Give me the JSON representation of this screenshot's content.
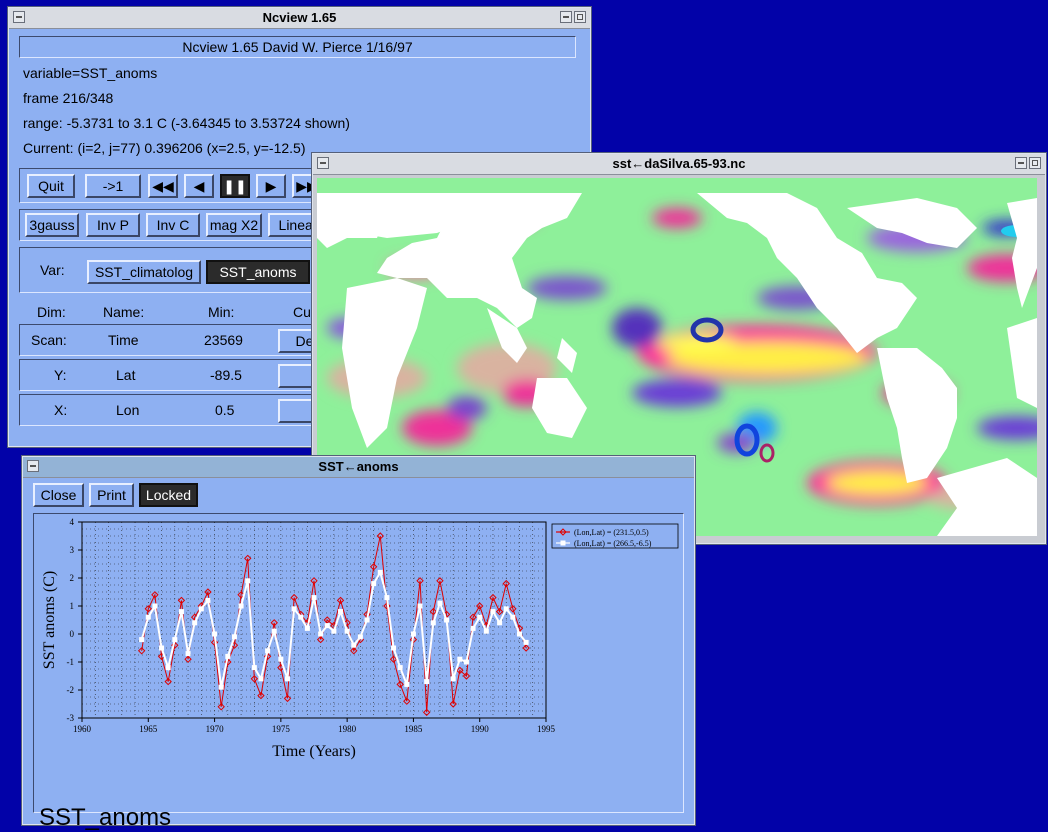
{
  "desktop": {
    "background": "#0202a8"
  },
  "ncview": {
    "title": "Ncview  1.65",
    "header": "Ncview 1.65 David W. Pierce 1/16/97",
    "variable": "variable=SST_anoms",
    "frame": "frame 216/348",
    "range": "range: -5.3731 to 3.1 C (-3.64345 to 3.53724 shown)",
    "current": "Current: (i=2, j=77) 0.396206 (x=2.5, y=-12.5)",
    "buttons": {
      "quit": "Quit",
      "restart": "->1"
    },
    "playback_icons": [
      "fast-backward-icon",
      "step-back-icon",
      "pause-icon",
      "step-forward-icon",
      "fast-forward-icon"
    ],
    "options": [
      "3gauss",
      "Inv P",
      "Inv C",
      "mag X2",
      "Linear"
    ],
    "var_label": "Var:",
    "vars": [
      "SST_climatolog",
      "SST_anoms"
    ],
    "dim_headers": {
      "dim": "Dim:",
      "name": "Name:",
      "min": "Min:",
      "cur": "Cu"
    },
    "dims": [
      {
        "dim": "Scan:",
        "name": "Time",
        "min": "23569",
        "btn": "Dec"
      },
      {
        "dim": "Y:",
        "name": "Lat",
        "min": "-89.5",
        "btn": ""
      },
      {
        "dim": "X:",
        "name": "Lon",
        "min": "0.5",
        "btn": ""
      }
    ]
  },
  "map_window": {
    "title": "sst←daSilva.65-93.nc"
  },
  "plot_window": {
    "title": "SST←anoms",
    "buttons": {
      "close": "Close",
      "print": "Print",
      "locked": "Locked"
    },
    "footer_label": "SST_anoms"
  },
  "chart_data": {
    "type": "line",
    "xlabel": "Time (Years)",
    "ylabel": "SST  anoms (C)",
    "xlim": [
      1960,
      1995
    ],
    "ylim": [
      -3,
      4
    ],
    "xticks": [
      1960,
      1965,
      1970,
      1975,
      1980,
      1985,
      1990,
      1995
    ],
    "yticks": [
      -3,
      -2,
      -1,
      0,
      1,
      2,
      3,
      4
    ],
    "grid": true,
    "legend_position": "top-right",
    "series": [
      {
        "name": "(Lon,Lat) = (231.5,0.5)",
        "color": "#e00000",
        "marker": "diamond",
        "x": [
          1964.5,
          1965.0,
          1965.5,
          1966.0,
          1966.5,
          1967.0,
          1967.5,
          1968.0,
          1968.5,
          1969.0,
          1969.5,
          1970.0,
          1970.5,
          1971.0,
          1971.5,
          1972.0,
          1972.5,
          1973.0,
          1973.5,
          1974.0,
          1974.5,
          1975.0,
          1975.5,
          1976.0,
          1976.5,
          1977.0,
          1977.5,
          1978.0,
          1978.5,
          1979.0,
          1979.5,
          1980.0,
          1980.5,
          1981.0,
          1981.5,
          1982.0,
          1982.5,
          1983.0,
          1983.5,
          1984.0,
          1984.5,
          1985.0,
          1985.5,
          1986.0,
          1986.5,
          1987.0,
          1987.5,
          1988.0,
          1988.5,
          1989.0,
          1989.5,
          1990.0,
          1990.5,
          1991.0,
          1991.5,
          1992.0,
          1992.5,
          1993.0,
          1993.5
        ],
        "y": [
          -0.6,
          0.9,
          1.4,
          -0.8,
          -1.7,
          -0.4,
          1.2,
          -0.9,
          0.6,
          1.0,
          1.5,
          -0.3,
          -2.6,
          -1.0,
          -0.4,
          1.4,
          2.7,
          -1.6,
          -2.2,
          -0.8,
          0.4,
          -1.2,
          -2.3,
          1.3,
          0.7,
          0.4,
          1.9,
          -0.2,
          0.5,
          0.3,
          1.2,
          0.4,
          -0.6,
          -0.2,
          0.7,
          2.4,
          3.5,
          1.0,
          -0.9,
          -1.8,
          -2.4,
          -0.2,
          1.9,
          -2.8,
          0.8,
          1.9,
          0.7,
          -2.5,
          -1.3,
          -1.5,
          0.6,
          1.0,
          0.3,
          1.3,
          0.8,
          1.8,
          0.9,
          0.2,
          -0.5
        ]
      },
      {
        "name": "(Lon,Lat) = (266.5,-6.5)",
        "color": "#ffffff",
        "marker": "square",
        "x": [
          1964.5,
          1965.0,
          1965.5,
          1966.0,
          1966.5,
          1967.0,
          1967.5,
          1968.0,
          1968.5,
          1969.0,
          1969.5,
          1970.0,
          1970.5,
          1971.0,
          1971.5,
          1972.0,
          1972.5,
          1973.0,
          1973.5,
          1974.0,
          1974.5,
          1975.0,
          1975.5,
          1976.0,
          1976.5,
          1977.0,
          1977.5,
          1978.0,
          1978.5,
          1979.0,
          1979.5,
          1980.0,
          1980.5,
          1981.0,
          1981.5,
          1982.0,
          1982.5,
          1983.0,
          1983.5,
          1984.0,
          1984.5,
          1985.0,
          1985.5,
          1986.0,
          1986.5,
          1987.0,
          1987.5,
          1988.0,
          1988.5,
          1989.0,
          1989.5,
          1990.0,
          1990.5,
          1991.0,
          1991.5,
          1992.0,
          1992.5,
          1993.0,
          1993.5
        ],
        "y": [
          -0.2,
          0.6,
          1.0,
          -0.5,
          -1.2,
          -0.2,
          0.8,
          -0.7,
          0.4,
          0.9,
          1.2,
          0.0,
          -1.9,
          -0.8,
          -0.1,
          1.0,
          1.9,
          -1.2,
          -1.6,
          -0.6,
          0.1,
          -0.9,
          -1.6,
          0.9,
          0.6,
          0.2,
          1.3,
          0.0,
          0.3,
          0.1,
          0.8,
          0.1,
          -0.4,
          -0.1,
          0.5,
          1.8,
          2.2,
          1.3,
          -0.5,
          -1.2,
          -1.8,
          0.0,
          1.0,
          -1.7,
          0.4,
          1.1,
          0.5,
          -1.6,
          -0.9,
          -1.0,
          0.2,
          0.6,
          0.1,
          0.8,
          0.4,
          0.9,
          0.6,
          0.0,
          -0.3
        ]
      }
    ]
  }
}
